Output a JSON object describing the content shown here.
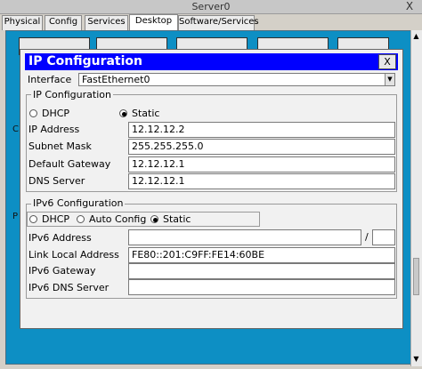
{
  "window": {
    "title": "Server0",
    "close_label": "X"
  },
  "tabs": [
    {
      "label": "Physical"
    },
    {
      "label": "Config"
    },
    {
      "label": "Services"
    },
    {
      "label": "Desktop"
    },
    {
      "label": "Software/Services"
    }
  ],
  "active_tab": "Desktop",
  "desktop": {
    "stray_labels": [
      "C",
      "P"
    ]
  },
  "dialog": {
    "title": "IP Configuration",
    "close_label": "X",
    "interface_label": "Interface",
    "interface_value": "FastEthernet0",
    "ipv4": {
      "group_title": "IP Configuration",
      "dhcp_label": "DHCP",
      "static_label": "Static",
      "mode": "static",
      "fields": [
        {
          "label": "IP Address",
          "value": "12.12.12.2"
        },
        {
          "label": "Subnet Mask",
          "value": "255.255.255.0"
        },
        {
          "label": "Default Gateway",
          "value": "12.12.12.1"
        },
        {
          "label": "DNS Server",
          "value": "12.12.12.1"
        }
      ]
    },
    "ipv6": {
      "group_title": "IPv6 Configuration",
      "dhcp_label": "DHCP",
      "auto_label": "Auto Config",
      "static_label": "Static",
      "mode": "static",
      "prefix_separator": "/",
      "fields": [
        {
          "label": "IPv6 Address",
          "value": ""
        },
        {
          "label": "Link Local Address",
          "value": "FE80::201:C9FF:FE14:60BE"
        },
        {
          "label": "IPv6 Gateway",
          "value": ""
        },
        {
          "label": "IPv6 DNS Server",
          "value": ""
        }
      ]
    }
  }
}
